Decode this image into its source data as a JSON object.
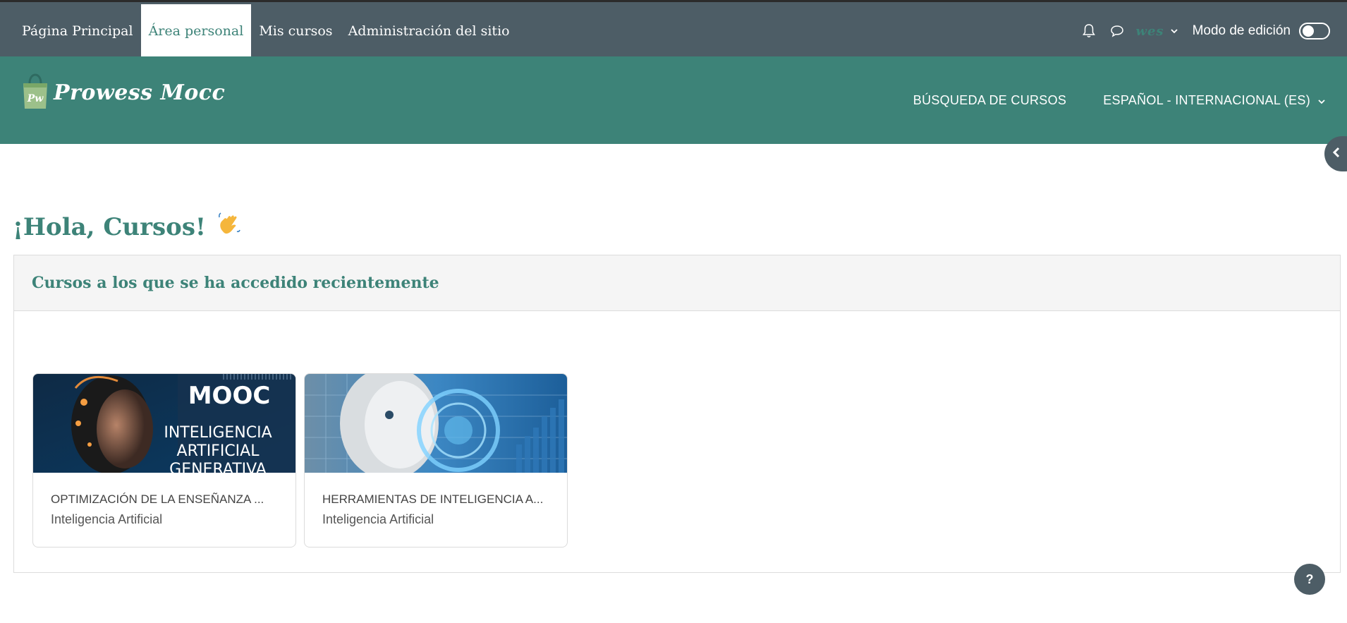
{
  "nav": {
    "items": [
      {
        "label": "Página Principal",
        "active": false
      },
      {
        "label": "Área personal",
        "active": true
      },
      {
        "label": "Mis cursos",
        "active": false
      },
      {
        "label": "Administración del sitio",
        "active": false
      }
    ],
    "user_initials": "wes",
    "edit_mode_label": "Modo de edición",
    "edit_mode_on": false
  },
  "brand": {
    "logo_text": "Prowess Mocc",
    "logo_badge": "Pw",
    "course_search": "BÚSQUEDA DE CURSOS",
    "language": "ESPAÑOL - INTERNACIONAL (ES)"
  },
  "greeting": "¡Hola, Cursos!",
  "greeting_emoji": "👋",
  "recent": {
    "title": "Cursos a los que se ha accedido recientemente",
    "courses": [
      {
        "title": "OPTIMIZACIÓN DE LA ENSEÑANZA ...",
        "category": "Inteligencia Artificial",
        "image_text": [
          "MOOC",
          "INTELIGENCIA",
          "ARTIFICIAL",
          "GENERATIVA"
        ]
      },
      {
        "title": "HERRAMIENTAS DE INTELIGENCIA A...",
        "category": "Inteligencia Artificial"
      }
    ]
  },
  "help_label": "?",
  "colors": {
    "topbar": "#4d5d66",
    "brand": "#3d8378",
    "accent_text": "#3d8378"
  }
}
